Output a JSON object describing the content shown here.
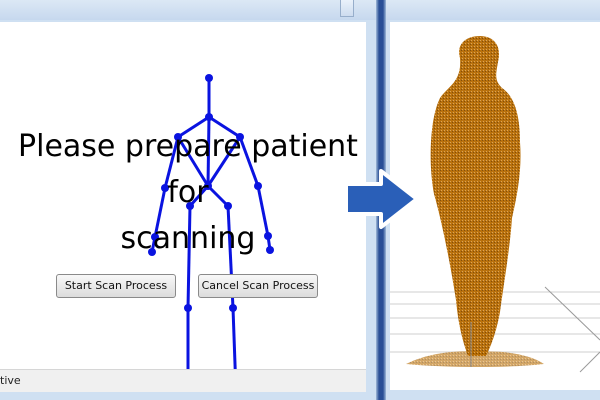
{
  "left_window": {
    "instruction_line1": "Please prepare patient for",
    "instruction_line2": "scanning",
    "start_button": "Start Scan Process",
    "cancel_button": "Cancel Scan Process",
    "status_text": "tive"
  },
  "colors": {
    "skeleton": "#0a13e0",
    "point_cloud": "#b56a00",
    "arrow": "#2a5fb8"
  }
}
